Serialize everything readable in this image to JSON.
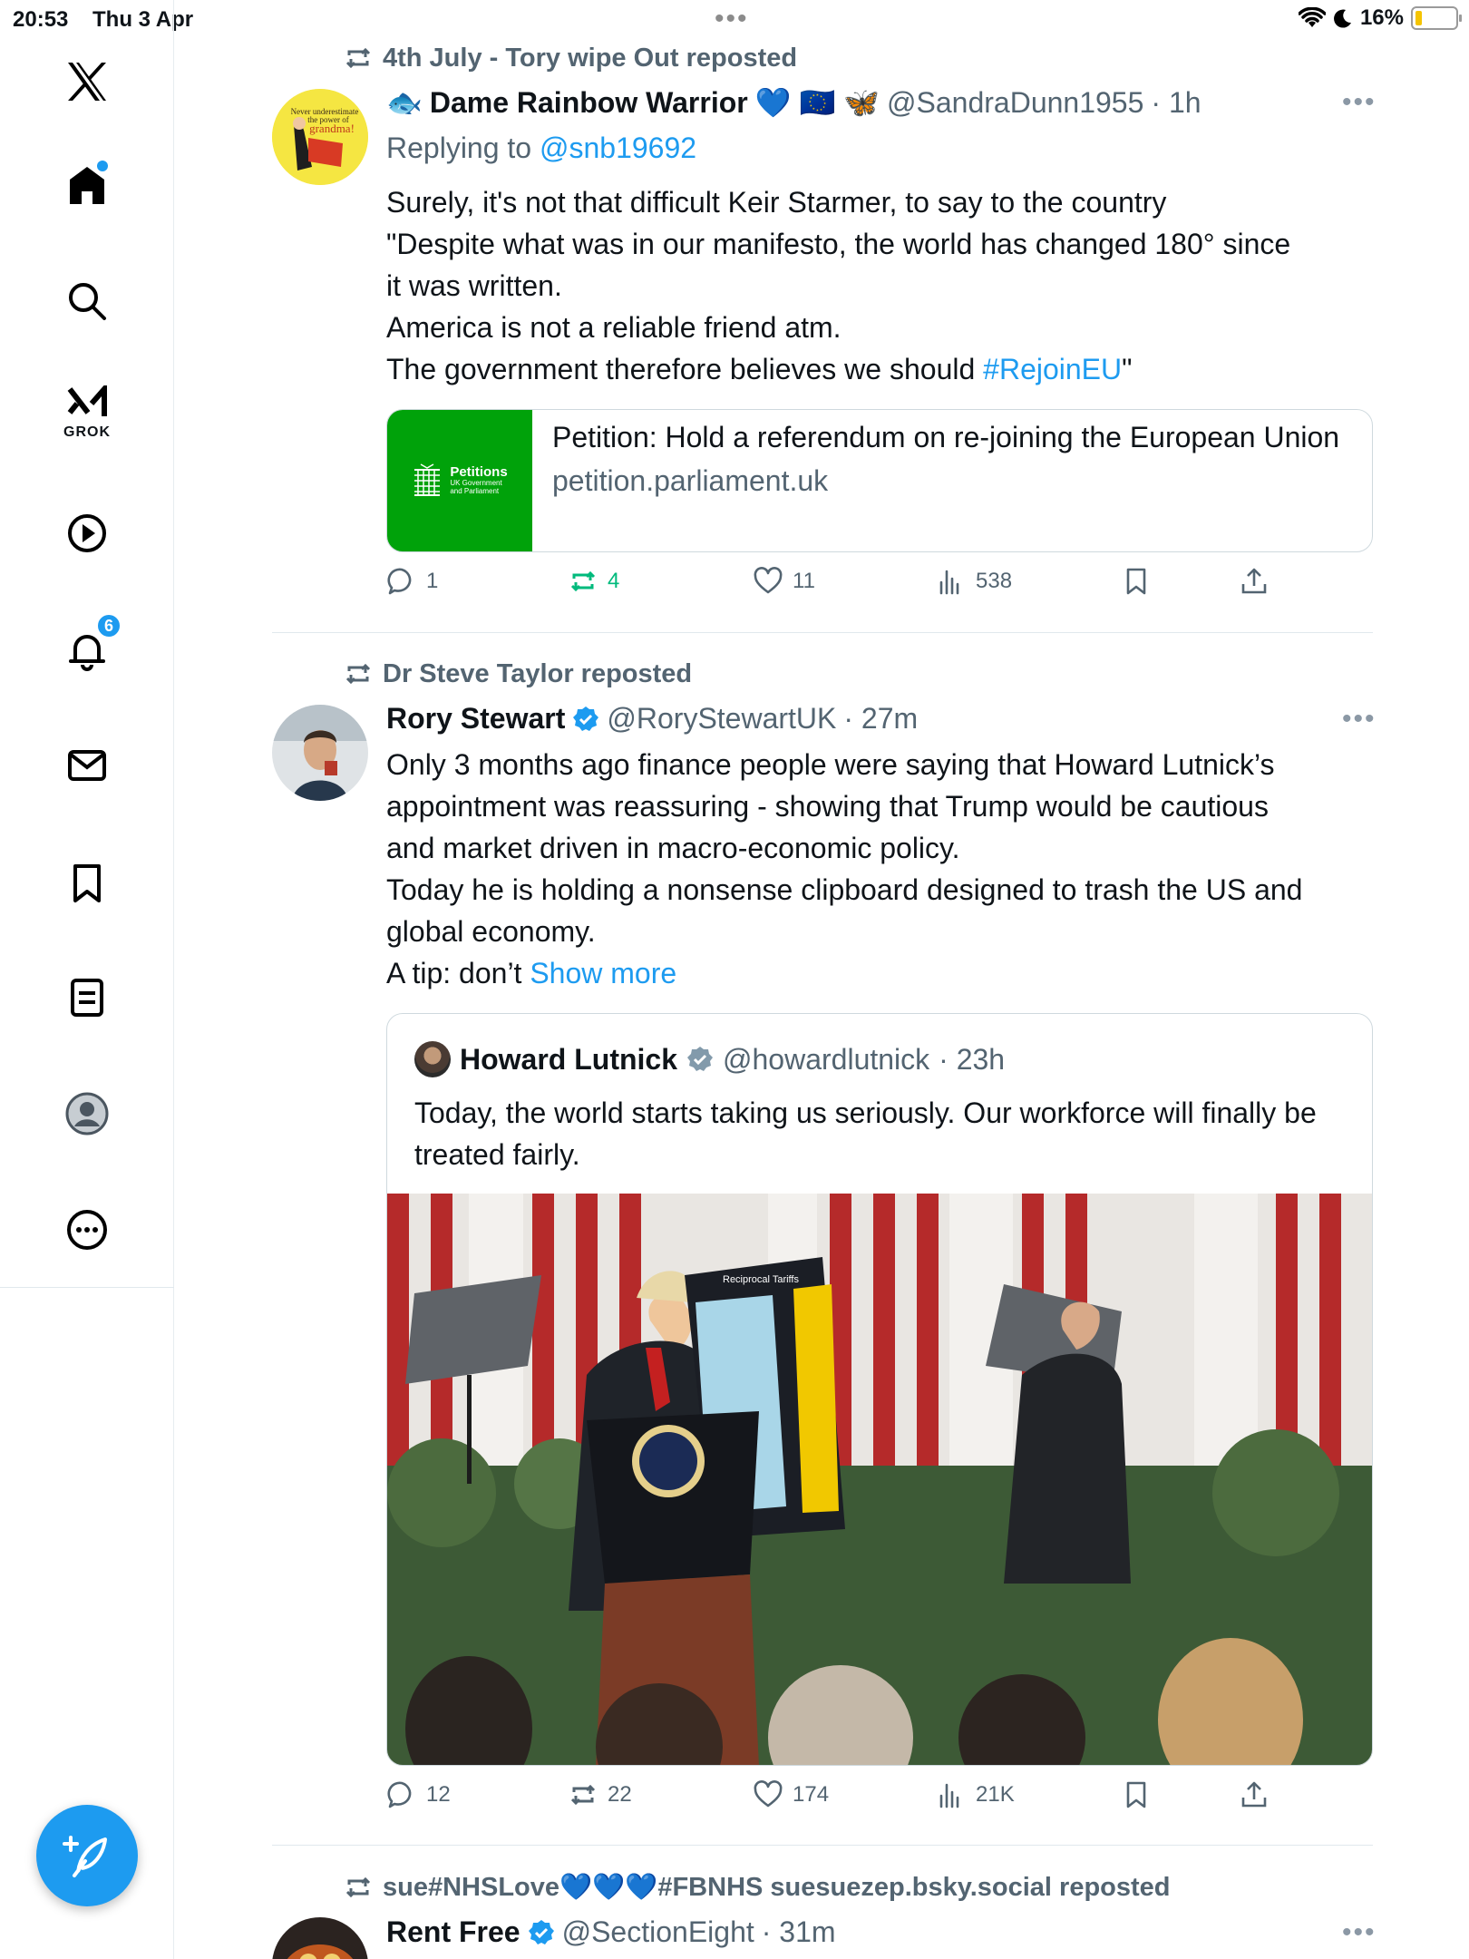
{
  "status_bar": {
    "time": "20:53",
    "date": "Thu 3 Apr",
    "battery": "16%",
    "battery_level": 0.16
  },
  "sidebar": {
    "grok_label": "GROK",
    "notifications_badge": "6",
    "compose_icon": "feather-plus-icon"
  },
  "tweets": [
    {
      "reposted_by": "4th July - Tory wipe Out reposted",
      "name": "Dame Rainbow Warrior",
      "name_emoji_prefix": "🐟",
      "name_emoji_suffix": "💙 🇪🇺 🦋",
      "handle": "@SandraDunn1955",
      "time": "· 1h",
      "replying_prefix": "Replying to",
      "replying_to": "@snb19692",
      "text_lines": [
        "Surely, it's not that difficult Keir Starmer, to say to the country",
        "\"Despite what was in our manifesto, the world has changed 180° since",
        "it was written.",
        "America is not a reliable friend atm.",
        "The government therefore believes we should "
      ],
      "hashtag": "#RejoinEU",
      "text_end": "\"",
      "card": {
        "thumb_title": "Petitions",
        "thumb_sub1": "UK Government",
        "thumb_sub2": "and Parliament",
        "title": "Petition: Hold a referendum on re-joining the European Union",
        "domain": "petition.parliament.uk"
      },
      "stats": {
        "replies": "1",
        "reposts": "4",
        "likes": "11",
        "views": "538"
      }
    },
    {
      "reposted_by": "Dr Steve Taylor reposted",
      "name": "Rory Stewart",
      "handle": "@RoryStewartUK",
      "time": "· 27m",
      "text_lines": [
        "Only 3 months ago finance people were saying that Howard Lutnick’s",
        "appointment was reassuring - showing that Trump would be cautious",
        "and market driven in macro-economic policy.",
        "Today he is holding a nonsense clipboard designed to trash the US and",
        "global economy.",
        "A tip: don’t "
      ],
      "show_more": "Show more",
      "quote": {
        "name": "Howard Lutnick",
        "handle": "@howardlutnick",
        "time": "· 23h",
        "text": "Today, the world starts taking us seriously. Our workforce will finally be treated fairly.",
        "board_title": "Reciprocal Tariffs"
      },
      "stats": {
        "replies": "12",
        "reposts": "22",
        "likes": "174",
        "views": "21K"
      }
    },
    {
      "reposted_by": "sue#NHSLove💙💙💙#FBNHS suesuezep.bsky.social reposted",
      "name": "Rent Free",
      "handle": "@SectionEight",
      "time": "· 31m"
    }
  ],
  "more_icon": "•••"
}
